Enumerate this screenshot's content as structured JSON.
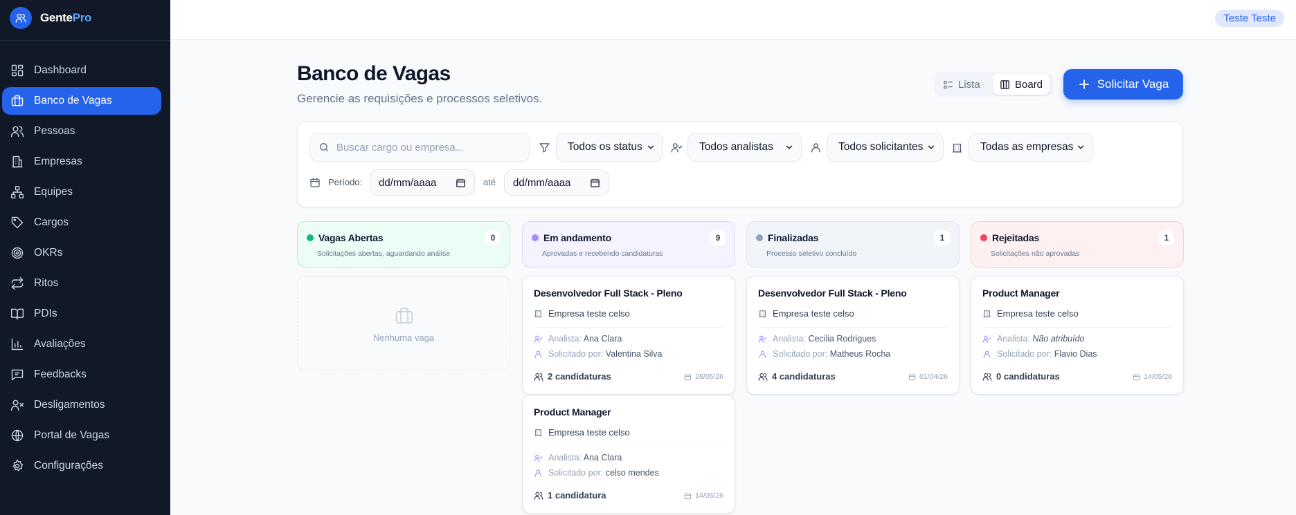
{
  "brand": {
    "name_main": "Gente",
    "name_accent": "Pro"
  },
  "user": {
    "name": "Teste Teste"
  },
  "nav": [
    {
      "label": "Dashboard",
      "icon": "layout-grid-icon"
    },
    {
      "label": "Banco de Vagas",
      "icon": "briefcase-icon",
      "active": true
    },
    {
      "label": "Pessoas",
      "icon": "users-icon"
    },
    {
      "label": "Empresas",
      "icon": "building-icon"
    },
    {
      "label": "Equipes",
      "icon": "network-icon"
    },
    {
      "label": "Cargos",
      "icon": "tag-icon"
    },
    {
      "label": "OKRs",
      "icon": "target-icon"
    },
    {
      "label": "Ritos",
      "icon": "repeat-icon"
    },
    {
      "label": "PDIs",
      "icon": "book-icon"
    },
    {
      "label": "Avaliações",
      "icon": "bar-chart-icon"
    },
    {
      "label": "Feedbacks",
      "icon": "message-icon"
    },
    {
      "label": "Desligamentos",
      "icon": "user-x-icon"
    },
    {
      "label": "Portal de Vagas",
      "icon": "globe-icon"
    },
    {
      "label": "Configurações",
      "icon": "settings-icon"
    }
  ],
  "page": {
    "title": "Banco de Vagas",
    "subtitle": "Gerencie as requisições e processos seletivos."
  },
  "view_toggle": {
    "list_label": "Lista",
    "board_label": "Board",
    "selected": "Board"
  },
  "primary_action": {
    "label": "Solicitar Vaga"
  },
  "filters": {
    "search_placeholder": "Buscar cargo ou empresa...",
    "status": "Todos os status",
    "analyst": "Todos analistas",
    "requester": "Todos solicitantes",
    "company": "Todas as empresas",
    "period_label": "Período:",
    "date_from": "dd/mm/aaaa",
    "between_label": "até",
    "date_to": "dd/mm/aaaa"
  },
  "columns": [
    {
      "title": "Vagas Abertas",
      "subtitle": "Solicitações abertas, aguardando análise",
      "count": "0",
      "color": "#10b981",
      "bg": "#ecfdf5",
      "border": "#a7f3d0"
    },
    {
      "title": "Em andamento",
      "subtitle": "Aprovadas e recebendo candidaturas",
      "count": "9",
      "color": "#a78bfa",
      "bg": "#f5f3ff",
      "border": "#ddd6fe"
    },
    {
      "title": "Finalizadas",
      "subtitle": "Processo seletivo concluído",
      "count": "1",
      "color": "#94a3b8",
      "bg": "#f1f5f9",
      "border": "#e2e8f0"
    },
    {
      "title": "Rejeitadas",
      "subtitle": "Solicitações não aprovadas",
      "count": "1",
      "color": "#f43f5e",
      "bg": "#fff1f2",
      "border": "#fecdd3"
    }
  ],
  "empty_column": {
    "text": "Nenhuma vaga"
  },
  "analyst_label": "Analista:",
  "requested_label": "Solicitado por:",
  "cards": [
    {
      "title": "Desenvolvedor Full Stack - Pleno",
      "company": "Empresa teste celso",
      "analyst": "Ana Clara",
      "requester": "Valentina Silva",
      "candidates": "2 candidaturas",
      "date": "28/05/26"
    },
    {
      "title": "Product Manager",
      "company": "Empresa teste celso",
      "analyst": "Ana Clara",
      "requester": "celso mendes",
      "candidates": "1 candidatura",
      "date": "14/05/26"
    },
    {
      "title": "Desenvolvedor Full Stack - Pleno",
      "company": "Empresa teste celso",
      "analyst": "Cecilia Rodrigues",
      "requester": "Matheus Rocha",
      "candidates": "4 candidaturas",
      "date": "01/04/26"
    },
    {
      "title": "Product Manager",
      "company": "Empresa teste celso",
      "analyst": "Não atribuído",
      "requester": "Flavio Dias",
      "candidates": "0 candidaturas",
      "date": "14/05/26"
    }
  ]
}
